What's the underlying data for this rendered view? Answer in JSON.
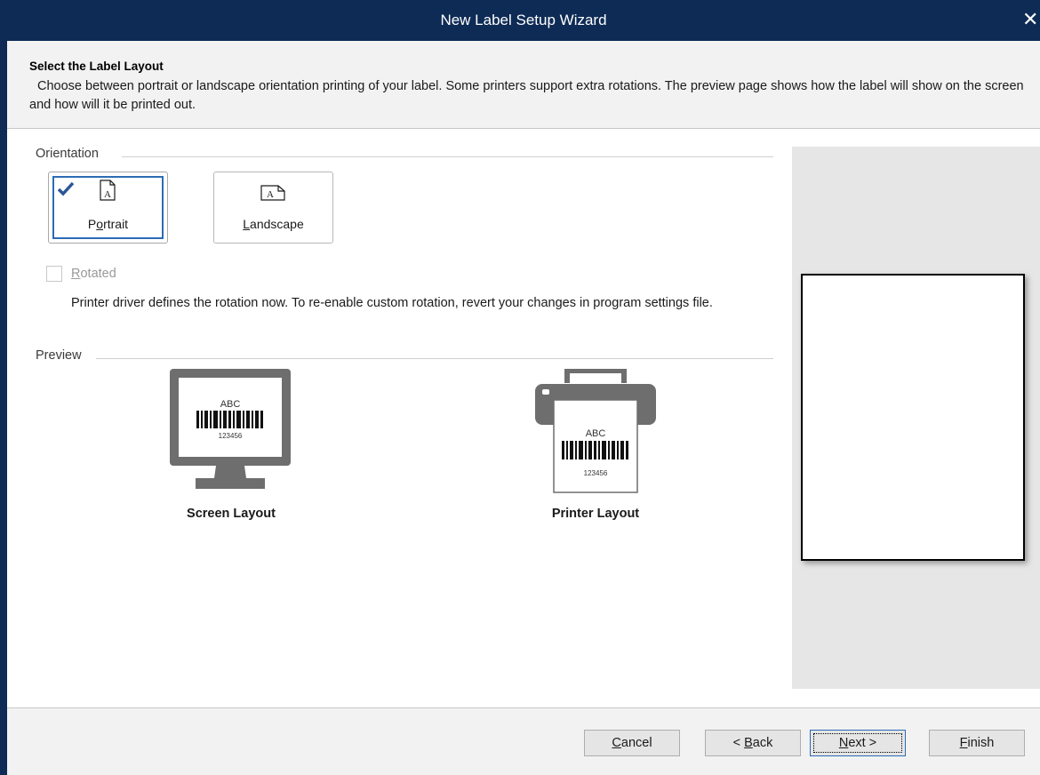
{
  "window": {
    "title": "New Label Setup Wizard",
    "close_glyph": "✕"
  },
  "header": {
    "title": "Select the Label Layout",
    "description": "Choose between portrait or landscape orientation printing of your label. Some printers support extra rotations. The preview page shows how the label will show on the screen and how will it be printed out."
  },
  "orientation": {
    "group_label": "Orientation",
    "portrait": {
      "label_pre": "P",
      "label_accel": "o",
      "label_post": "rtrait",
      "selected": true
    },
    "landscape": {
      "label_pre": "",
      "label_accel": "L",
      "label_post": "andscape",
      "selected": false
    }
  },
  "rotated": {
    "label_accel": "R",
    "label_rest": "otated",
    "checked": false,
    "enabled": false,
    "note": "Printer driver defines the rotation now. To re-enable custom rotation, revert your changes in program settings file."
  },
  "preview": {
    "group_label": "Preview",
    "screen": {
      "caption": "Screen Layout",
      "barcode_top": "ABC",
      "barcode_bottom": "123456"
    },
    "printer": {
      "caption": "Printer Layout",
      "barcode_top": "ABC",
      "barcode_bottom": "123456"
    }
  },
  "footer": {
    "cancel": {
      "accel": "C",
      "rest": "ancel"
    },
    "back": {
      "pre": "< ",
      "accel": "B",
      "rest": "ack"
    },
    "next": {
      "accel": "N",
      "rest": "ext >"
    },
    "finish": {
      "accel": "F",
      "rest": "inish"
    }
  },
  "colors": {
    "titlebar": "#0d2b55",
    "selection_border": "#2b6cb5",
    "icon_gray": "#6e6e6e",
    "check_blue": "#2b5797"
  },
  "icons": {
    "check": "checkmark-icon",
    "portrait_page": "portrait-page-icon",
    "landscape_page": "landscape-page-icon",
    "screen": "monitor-icon",
    "printer": "printer-icon"
  }
}
